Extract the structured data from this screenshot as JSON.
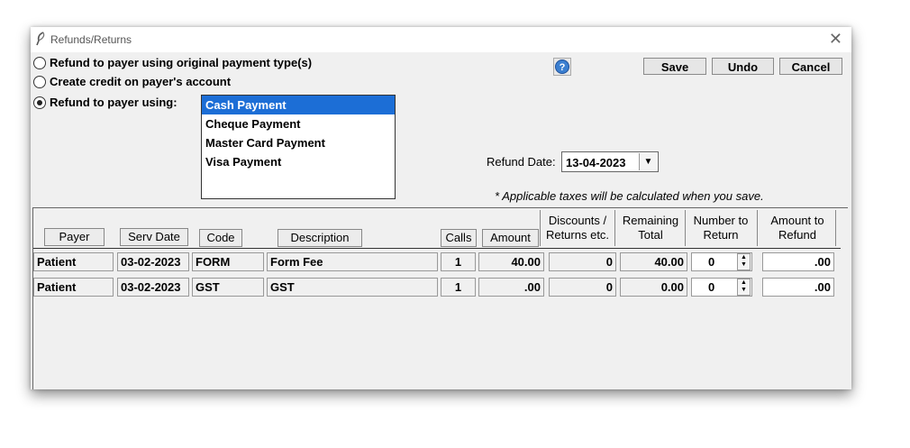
{
  "window": {
    "title": "Refunds/Returns"
  },
  "options": {
    "original_type": "Refund to payer using original payment type(s)",
    "credit_account": "Create credit on payer's account",
    "refund_using": "Refund to payer using:",
    "selected": "refund_using"
  },
  "payment_methods": [
    "Cash Payment",
    "Cheque Payment",
    "Master Card Payment",
    "Visa Payment"
  ],
  "selected_payment_method": "Cash Payment",
  "buttons": {
    "save": "Save",
    "undo": "Undo",
    "cancel": "Cancel",
    "help_icon": "help-icon"
  },
  "refund_date": {
    "label": "Refund Date:",
    "value": "13-04-2023"
  },
  "tax_note": "* Applicable taxes will be calculated when you save.",
  "table": {
    "headers": {
      "payer": "Payer",
      "serv_date": "Serv Date",
      "code": "Code",
      "description": "Description",
      "calls": "Calls",
      "amount": "Amount",
      "discounts_1": "Discounts /",
      "discounts_2": "Returns etc.",
      "remaining_1": "Remaining",
      "remaining_2": "Total",
      "number_1": "Number to",
      "number_2": "Return",
      "refund_1": "Amount to",
      "refund_2": "Refund"
    },
    "rows": [
      {
        "payer": "Patient",
        "serv_date": "03-02-2023",
        "code": "FORM",
        "description": "Form Fee",
        "calls": "1",
        "amount": "40.00",
        "discounts": "0",
        "remaining": "40.00",
        "number_to_return": "0",
        "amount_to_refund": ".00"
      },
      {
        "payer": "Patient",
        "serv_date": "03-02-2023",
        "code": "GST",
        "description": "GST",
        "calls": "1",
        "amount": ".00",
        "discounts": "0",
        "remaining": "0.00",
        "number_to_return": "0",
        "amount_to_refund": ".00"
      }
    ]
  }
}
